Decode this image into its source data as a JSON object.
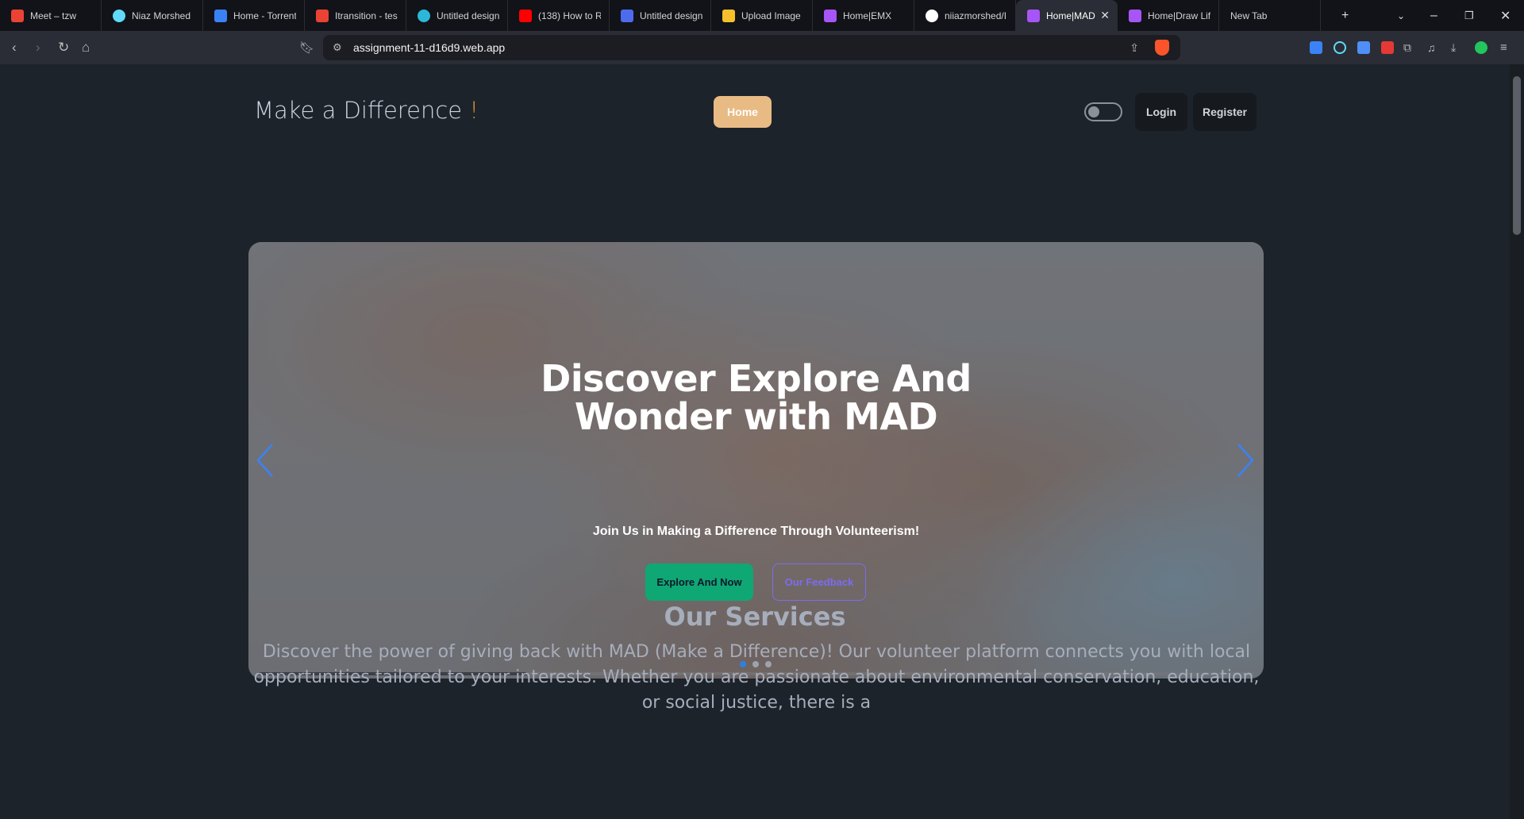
{
  "browser": {
    "tabs": [
      {
        "title": "Meet – tzw",
        "icon": "meet-icon",
        "color": "#ea4335"
      },
      {
        "title": "Niaz Morshed",
        "icon": "react-icon",
        "color": "#61dafb"
      },
      {
        "title": "Home - Torrent",
        "icon": "torrent-icon",
        "color": "#3b82f6"
      },
      {
        "title": "Itransition - tes",
        "icon": "gmail-icon",
        "color": "#ea4335"
      },
      {
        "title": "Untitled design",
        "icon": "canva-icon",
        "color": "#2bb8d8"
      },
      {
        "title": "(138) How to R",
        "icon": "youtube-icon",
        "color": "#ff0000"
      },
      {
        "title": "Untitled design",
        "icon": "doc-icon",
        "color": "#4f6bed"
      },
      {
        "title": "Upload Image",
        "icon": "upload-icon",
        "color": "#f5c02b"
      },
      {
        "title": "Home|EMX",
        "icon": "vite-icon",
        "color": "#a855f7"
      },
      {
        "title": "niiazmorshed/I",
        "icon": "github-icon",
        "color": "#ffffff"
      },
      {
        "title": "Home|MAD",
        "icon": "vite-icon",
        "color": "#a855f7",
        "active": true
      },
      {
        "title": "Home|Draw Lif",
        "icon": "vite-icon",
        "color": "#a855f7"
      },
      {
        "title": "New Tab",
        "icon": "",
        "color": ""
      }
    ],
    "url": "assignment-11-d16d9.web.app"
  },
  "nav": {
    "brand": "Make a Difference",
    "brand_mark": "!",
    "home": "Home",
    "login": "Login",
    "register": "Register"
  },
  "hero": {
    "title": "Discover Explore And Wonder with MAD",
    "subtitle": "Join Us in Making a Difference Through Volunteerism!",
    "explore_button": "Explore And Now",
    "feedback_button": "Our Feedback",
    "active_slide": 1,
    "slide_count": 3,
    "progress": 0.27
  },
  "services": {
    "title": "Our Services",
    "text": "Discover the power of giving back with MAD (Make a Difference)! Our volunteer platform connects you with local opportunities tailored to your interests. Whether you are passionate about environmental conservation, education, or social justice, there is a"
  },
  "colors": {
    "accent": "#e9bb84",
    "explore": "#0fa774",
    "feedback": "#7c6cf0"
  }
}
